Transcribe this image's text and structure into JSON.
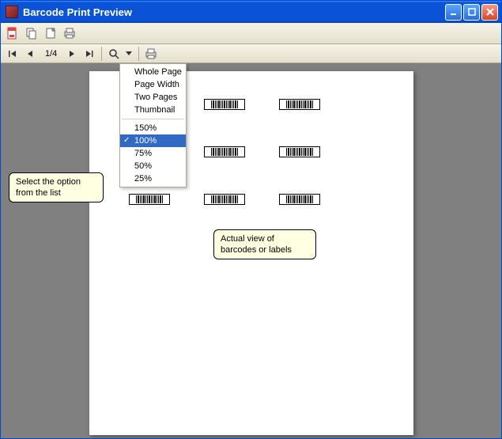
{
  "window": {
    "title": "Barcode Print Preview"
  },
  "toolbar2": {
    "page_indicator": "1/4"
  },
  "zoom_menu": {
    "items": [
      {
        "label": "Whole Page",
        "checked": false,
        "selected": false
      },
      {
        "label": "Page Width",
        "checked": false,
        "selected": false
      },
      {
        "label": "Two Pages",
        "checked": false,
        "selected": false
      },
      {
        "label": "Thumbnail",
        "checked": false,
        "selected": false
      }
    ],
    "zoom_levels": [
      {
        "label": "150%",
        "checked": false,
        "selected": false
      },
      {
        "label": "100%",
        "checked": true,
        "selected": true
      },
      {
        "label": "75%",
        "checked": false,
        "selected": false
      },
      {
        "label": "50%",
        "checked": false,
        "selected": false
      },
      {
        "label": "25%",
        "checked": false,
        "selected": false
      }
    ]
  },
  "callouts": {
    "left": "Select the option from the list",
    "right": "Actual view of barcodes or labels"
  }
}
